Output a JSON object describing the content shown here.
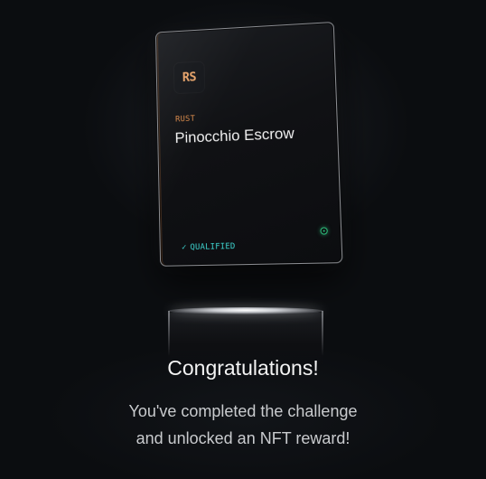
{
  "card": {
    "badge": "RS",
    "language": "RUST",
    "title": "Pinocchio Escrow",
    "check_glyph": "✓",
    "status": "QUALIFIED",
    "status_icon": "status-dot-icon"
  },
  "completion": {
    "heading": "Congratulations!",
    "message_line1": "You've completed the challenge",
    "message_line2": "and unlocked an NFT reward!"
  },
  "colors": {
    "background": "#0b0d10",
    "rust_accent": "#d98a4a",
    "qualified": "#3fd6d2",
    "status_green": "#2ec27e"
  }
}
